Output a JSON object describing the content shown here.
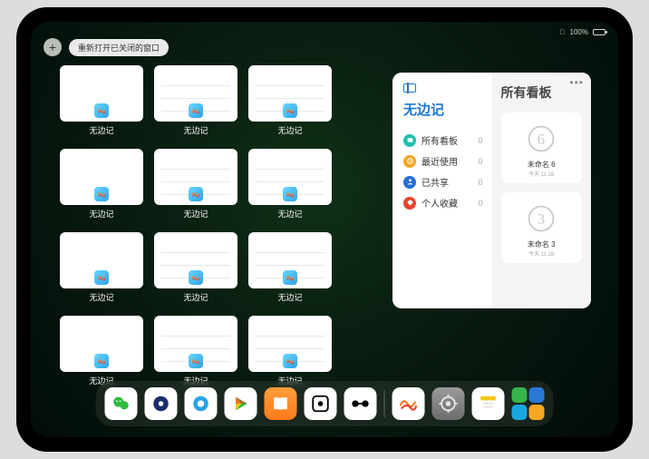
{
  "statusbar": {
    "battery_text": "100%"
  },
  "topbar": {
    "add_label": "+",
    "reopen_label": "重新打开已关闭的窗口"
  },
  "app_name": "无边记",
  "thumbs": [
    {
      "label": "无边记",
      "variant": "blank"
    },
    {
      "label": "无边记",
      "variant": "lines"
    },
    {
      "label": "无边记",
      "variant": "lines"
    },
    {
      "label": "无边记",
      "variant": "blank"
    },
    {
      "label": "无边记",
      "variant": "lines"
    },
    {
      "label": "无边记",
      "variant": "lines"
    },
    {
      "label": "无边记",
      "variant": "blank"
    },
    {
      "label": "无边记",
      "variant": "lines"
    },
    {
      "label": "无边记",
      "variant": "lines"
    },
    {
      "label": "无边记",
      "variant": "blank"
    },
    {
      "label": "无边记",
      "variant": "lines"
    },
    {
      "label": "无边记",
      "variant": "lines"
    }
  ],
  "panel": {
    "title": "无边记",
    "categories": [
      {
        "label": "所有看板",
        "count": "0",
        "color": "#20c0ad"
      },
      {
        "label": "最近使用",
        "count": "0",
        "color": "#f5a623"
      },
      {
        "label": "已共享",
        "count": "0",
        "color": "#2a6ed6"
      },
      {
        "label": "个人收藏",
        "count": "0",
        "color": "#e8442e"
      }
    ],
    "right_title": "所有看板",
    "boards": [
      {
        "name": "未命名 6",
        "sub": "今天 11:28",
        "glyph": "6"
      },
      {
        "name": "未命名 3",
        "sub": "今天 11:28",
        "glyph": "3"
      }
    ]
  },
  "dock": {
    "icons": [
      {
        "name": "wechat",
        "bg": "#ffffff"
      },
      {
        "name": "circle-blue",
        "bg": "#ffffff"
      },
      {
        "name": "circle-lightblue",
        "bg": "#ffffff"
      },
      {
        "name": "play-tri",
        "bg": "#ffffff"
      },
      {
        "name": "books",
        "bg": "linear-gradient(#ff9d3a,#ff7a1a)"
      },
      {
        "name": "dot-square",
        "bg": "#ffffff"
      },
      {
        "name": "barbell",
        "bg": "#ffffff"
      }
    ],
    "icons_right": [
      {
        "name": "freeform",
        "bg": "#ffffff"
      },
      {
        "name": "settings",
        "bg": "linear-gradient(#9a9a9a,#6d6d6d)"
      },
      {
        "name": "notes",
        "bg": "#ffffff"
      }
    ],
    "quad_colors": [
      "#36b34a",
      "#2a78d6",
      "#1aa6e0",
      "#f5a623"
    ]
  }
}
